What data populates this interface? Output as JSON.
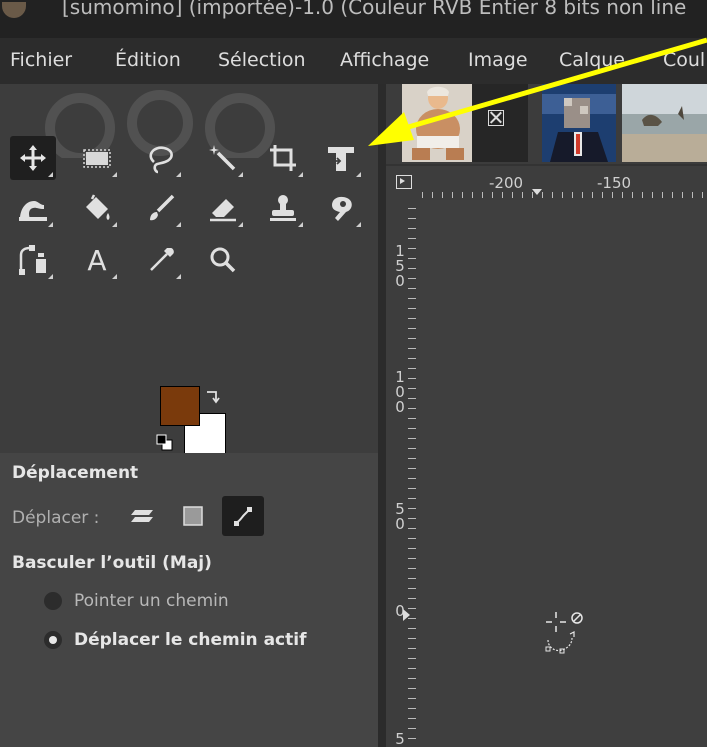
{
  "window": {
    "title": "[sumomino] (importée)-1.0 (Couleur RVB Entier 8 bits non line"
  },
  "menu": [
    "Fichier",
    "Édition",
    "Sélection",
    "Affichage",
    "Image",
    "Calque",
    "Coul"
  ],
  "toolbox": {
    "tools": [
      {
        "name": "move-tool",
        "icon": "move-icon",
        "active": true
      },
      {
        "name": "rect-select-tool",
        "icon": "rect-select-icon"
      },
      {
        "name": "free-select-tool",
        "icon": "lasso-icon"
      },
      {
        "name": "fuzzy-select-tool",
        "icon": "magic-wand-icon"
      },
      {
        "name": "crop-tool",
        "icon": "crop-icon"
      },
      {
        "name": "unified-transform-tool",
        "icon": "transform-icon"
      },
      {
        "name": "warp-tool",
        "icon": "warp-icon"
      },
      {
        "name": "bucket-fill-tool",
        "icon": "bucket-icon"
      },
      {
        "name": "paintbrush-tool",
        "icon": "brush-icon"
      },
      {
        "name": "eraser-tool",
        "icon": "eraser-icon"
      },
      {
        "name": "clone-tool",
        "icon": "stamp-icon"
      },
      {
        "name": "smudge-tool",
        "icon": "smudge-icon"
      },
      {
        "name": "paths-tool",
        "icon": "paths-icon"
      },
      {
        "name": "text-tool",
        "icon": "text-icon",
        "label": "A"
      },
      {
        "name": "color-picker-tool",
        "icon": "eyedropper-icon"
      },
      {
        "name": "zoom-tool",
        "icon": "zoom-icon"
      }
    ],
    "fg_color": "#7a3a0c",
    "bg_color": "#ffffff"
  },
  "tool_options": {
    "title": "Déplacement",
    "move_label": "Déplacer :",
    "toggle_label": "Basculer l’outil (Maj)",
    "radio_options": [
      {
        "label": "Pointer un chemin",
        "checked": false
      },
      {
        "label": "Déplacer le chemin actif",
        "checked": true
      }
    ]
  },
  "ruler": {
    "h_labels": [
      "-200",
      "-150"
    ],
    "v_labels": [
      "1\n5\n0",
      "1\n0\n0",
      "5\n0",
      "0",
      "5"
    ]
  },
  "annotation": {
    "arrow_color": "#ffff00"
  }
}
